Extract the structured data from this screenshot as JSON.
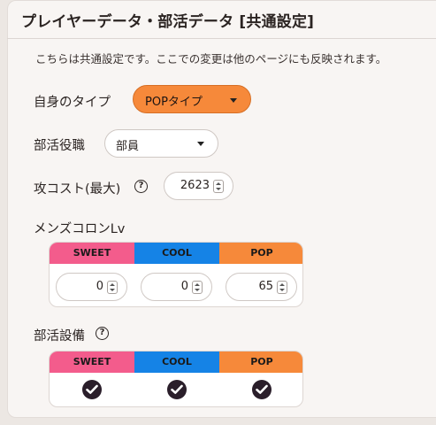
{
  "title": "プレイヤーデータ・部活データ [共通設定]",
  "description": "こちらは共通設定です。ここでの変更は他のページにも反映されます。",
  "self_type": {
    "label": "自身のタイプ",
    "value": "POPタイプ",
    "accent": "#f6893a"
  },
  "club_role": {
    "label": "部活役職",
    "value": "部員"
  },
  "attack_cost": {
    "label": "攻コスト(最大)",
    "value": "2623"
  },
  "mens_colon": {
    "label": "メンズコロンLv",
    "headers": [
      "SWEET",
      "COOL",
      "POP"
    ],
    "values": [
      "0",
      "0",
      "65"
    ]
  },
  "club_equipment": {
    "label": "部活設備",
    "headers": [
      "SWEET",
      "COOL",
      "POP"
    ],
    "checked": [
      true,
      true,
      true
    ]
  },
  "colors": {
    "sweet": "#f35c8c",
    "cool": "#1583e6",
    "pop": "#f6893a"
  },
  "icons": {
    "help": "help-circle-icon",
    "dropdown": "caret-down-icon",
    "check": "check-circle-icon",
    "spinner": "number-spinner-icon"
  }
}
